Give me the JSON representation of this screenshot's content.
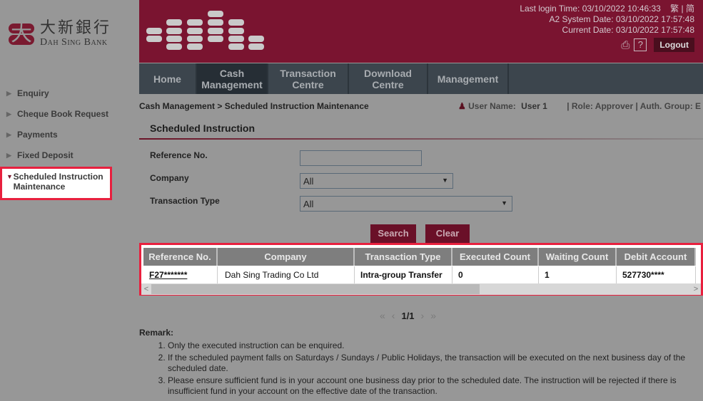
{
  "brand": {
    "name_cn": "大新銀行",
    "name_en": "Dah Sing Bank",
    "logo_glyph": "大",
    "primary_color": "#7a1430",
    "highlight_color": "#e8203e"
  },
  "header": {
    "last_login": "Last login Time: 03/10/2022 10:46:33",
    "lang_trad": "繁",
    "lang_sep": "|",
    "lang_simp": "简",
    "system_date": "A2 System Date: 03/10/2022 17:57:48",
    "current_date": "Current Date: 03/10/2022 17:57:48",
    "print_icon": "printer-icon",
    "help_label": "?",
    "logout_label": "Logout"
  },
  "nav": {
    "items": [
      {
        "label": "Home",
        "active": false
      },
      {
        "label": "Cash Management",
        "active": true
      },
      {
        "label": "Transaction Centre",
        "active": false
      },
      {
        "label": "Download Centre",
        "active": false
      },
      {
        "label": "Management",
        "active": false
      }
    ]
  },
  "sidebar": {
    "items": [
      {
        "label": "Enquiry",
        "arrow": "▶"
      },
      {
        "label": "Cheque Book Request",
        "arrow": "▶"
      },
      {
        "label": "Payments",
        "arrow": "▶"
      },
      {
        "label": "Fixed Deposit",
        "arrow": "▶"
      },
      {
        "label": "Scheduled Instruction Maintenance",
        "arrow": "▼",
        "active": true
      }
    ]
  },
  "breadcrumb": "Cash Management > Scheduled Instruction Maintenance",
  "user": {
    "icon": "user-icon",
    "name_label": "User Name:",
    "name_value": "User 1",
    "role_text": "| Role: Approver | Auth. Group: E"
  },
  "page_title": "Scheduled Instruction",
  "form": {
    "reference_label": "Reference No.",
    "reference_value": "",
    "company_label": "Company",
    "company_value": "All",
    "txn_type_label": "Transaction Type",
    "txn_type_value": "All",
    "search_label": "Search",
    "clear_label": "Clear"
  },
  "table": {
    "columns": [
      "Reference No.",
      "Company",
      "Transaction Type",
      "Executed Count",
      "Waiting Count",
      "Debit Account"
    ],
    "rows": [
      [
        "F27*******",
        "Dah Sing Trading Co Ltd",
        "Intra-group Transfer",
        "0",
        "1",
        "527730****"
      ]
    ]
  },
  "pager": {
    "first": "«",
    "prev": "‹",
    "page": "1/1",
    "next": "›",
    "last": "»"
  },
  "remark": {
    "title": "Remark:",
    "items": [
      "Only the executed instruction can be enquired.",
      "If the scheduled payment falls on Saturdays / Sundays / Public Holidays, the transaction will be executed on the next business day of the scheduled date.",
      "Please ensure sufficient fund is in your account one business day prior to the scheduled date. The instruction will be rejected if there is insufficient fund in your account on the effective date of the transaction."
    ]
  }
}
